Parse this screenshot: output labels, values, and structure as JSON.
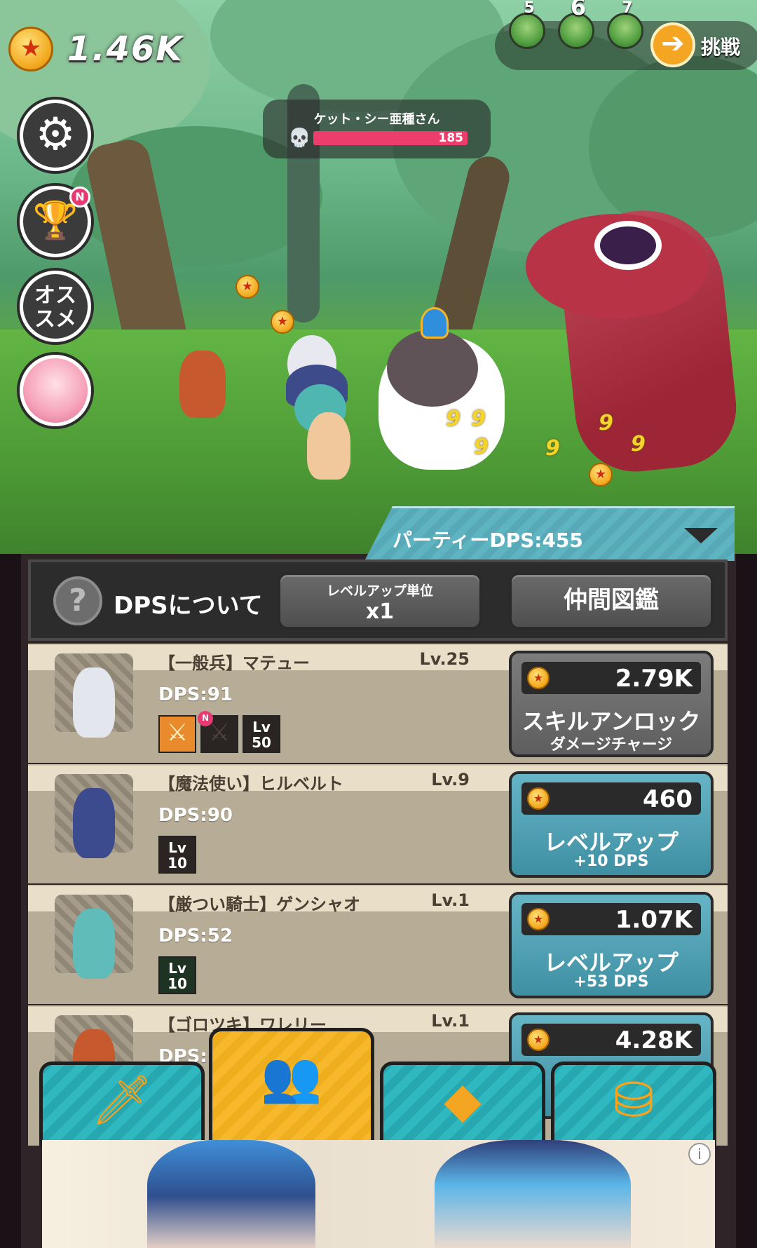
{
  "hud": {
    "coins": "1.46K",
    "stages": [
      "5",
      "6",
      "7"
    ],
    "current_stage": "6",
    "challenge_label": "挑戦"
  },
  "boss": {
    "name": "ケット・シー亜種さん",
    "hp": "185"
  },
  "side_menu": {
    "recommend_label_1": "オス",
    "recommend_label_2": "スメ",
    "trophy_badge": "N"
  },
  "damage_numbers": [
    "9",
    "9",
    "9",
    "9",
    "9",
    "9"
  ],
  "party": {
    "dps_label": "パーティーDPS:455",
    "help_label": "DPSについて",
    "levelup_unit_title": "レベルアップ単位",
    "levelup_unit_value": "x1",
    "book_label": "仲間図鑑"
  },
  "members": [
    {
      "name": "【一般兵】マテュー",
      "level": "Lv.25",
      "dps": "DPS:91",
      "skills": [
        {
          "type": "sword-gold"
        },
        {
          "type": "sword-locked",
          "badge": "N"
        },
        {
          "type": "level",
          "label": "Lv",
          "value": "50"
        }
      ],
      "price": "2.79K",
      "action": "スキルアンロック",
      "action_sub": "ダメージチャージ",
      "style": "gray"
    },
    {
      "name": "【魔法使い】ヒルベルト",
      "level": "Lv.9",
      "dps": "DPS:90",
      "skills": [
        {
          "type": "level",
          "label": "Lv",
          "value": "10"
        }
      ],
      "price": "460",
      "action": "レベルアップ",
      "action_sub": "+10 DPS",
      "style": "teal"
    },
    {
      "name": "【厳つい騎士】ゲンシャオ",
      "level": "Lv.1",
      "dps": "DPS:52",
      "skills": [
        {
          "type": "level",
          "label": "Lv",
          "value": "10"
        }
      ],
      "price": "1.07K",
      "action": "レベルアップ",
      "action_sub": "+53 DPS",
      "style": "teal"
    },
    {
      "name": "【ゴロツキ】ワレリー",
      "level": "Lv.1",
      "dps": "DPS:",
      "price": "4.28K"
    }
  ],
  "bottom_nav": [
    {
      "name": "weapon-tab",
      "icon": "sword-icon",
      "active": false
    },
    {
      "name": "party-tab",
      "icon": "party-icon",
      "active": true
    },
    {
      "name": "crystal-tab",
      "icon": "crystal-icon",
      "active": false
    },
    {
      "name": "coin-tab",
      "icon": "coin-stack-icon",
      "active": false
    }
  ],
  "colors": {
    "teal": "#2fb8c0",
    "gold": "#f7b92b",
    "hp_bar": "#ec3d6c",
    "action_teal": "#4f9fb2"
  }
}
